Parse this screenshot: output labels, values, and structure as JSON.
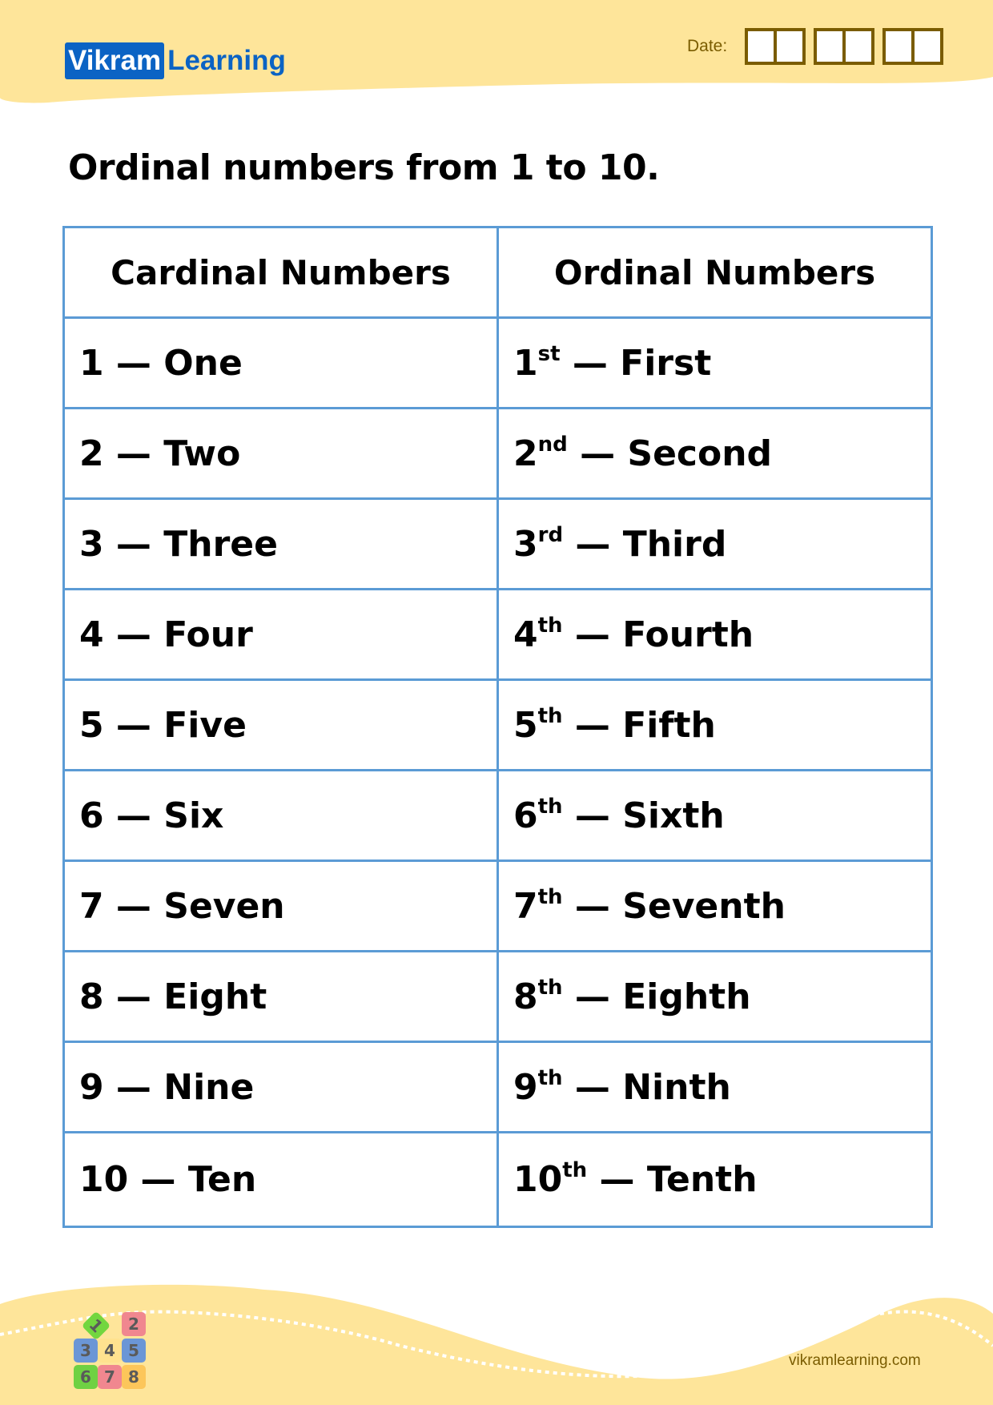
{
  "header": {
    "logo": {
      "part1": "Vikram",
      "part2": "Learning"
    },
    "date_label": "Date:",
    "date_groups": [
      2,
      2,
      2
    ]
  },
  "title": "Ordinal numbers from 1 to 10.",
  "table": {
    "headers": [
      "Cardinal Numbers",
      "Ordinal Numbers"
    ],
    "rows": [
      {
        "cardinal": "1 — One",
        "num": "1",
        "suffix": "st",
        "word": " — First"
      },
      {
        "cardinal": "2 — Two",
        "num": "2",
        "suffix": "nd",
        "word": " — Second"
      },
      {
        "cardinal": "3 — Three",
        "num": "3",
        "suffix": "rd",
        "word": " — Third"
      },
      {
        "cardinal": "4 — Four",
        "num": "4",
        "suffix": "th",
        "word": " — Fourth"
      },
      {
        "cardinal": "5 — Five",
        "num": "5",
        "suffix": "th",
        "word": " — Fifth"
      },
      {
        "cardinal": "6 — Six",
        "num": "6",
        "suffix": "th",
        "word": " — Sixth"
      },
      {
        "cardinal": "7 — Seven",
        "num": "7",
        "suffix": "th",
        "word": " — Seventh"
      },
      {
        "cardinal": "8 — Eight",
        "num": "8",
        "suffix": "th",
        "word": " — Eighth"
      },
      {
        "cardinal": "9 — Nine",
        "num": "9",
        "suffix": "th",
        "word": " — Ninth"
      },
      {
        "cardinal": "10 — Ten",
        "num": "10",
        "suffix": "th",
        "word": " — Tenth"
      }
    ]
  },
  "footer": {
    "website": "vikramlearning.com",
    "icon_digits": [
      "1",
      "2",
      "3",
      "4",
      "5",
      "6",
      "7",
      "8"
    ]
  },
  "colors": {
    "banner": "#fee59a",
    "brand_blue": "#0b63c4",
    "table_border": "#5b9bd5",
    "date_brown": "#7a5c00"
  }
}
